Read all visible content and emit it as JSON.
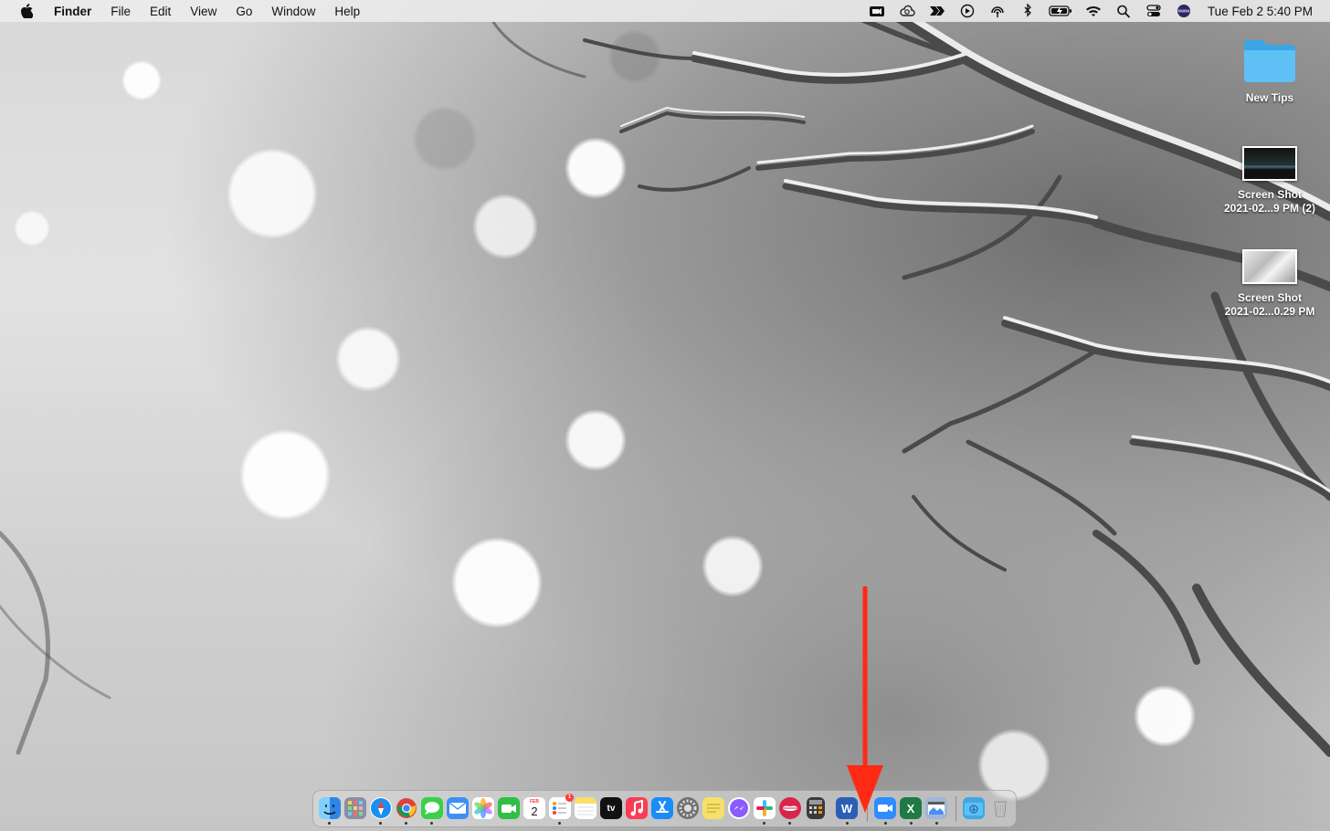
{
  "menubar": {
    "apple_icon": "apple-logo",
    "app_name": "Finder",
    "menus": [
      "File",
      "Edit",
      "View",
      "Go",
      "Window",
      "Help"
    ],
    "status_icons": [
      "video-record-icon",
      "cloud-sync-icon",
      "fast-forward-icon",
      "play-circle-icon",
      "airdrop-icon",
      "bluetooth-icon",
      "battery-charging-icon",
      "wifi-icon",
      "spotlight-search-icon",
      "control-center-icon",
      "siri-icon"
    ],
    "clock": "Tue Feb 2  5:40 PM"
  },
  "desktop": {
    "items": [
      {
        "label": "New Tips",
        "type": "folder"
      },
      {
        "label_line1": "Screen Shot",
        "label_line2": "2021-02...9 PM (2)",
        "type": "screenshot"
      },
      {
        "label_line1": "Screen Shot",
        "label_line2": "2021-02...0.29 PM",
        "type": "screenshot"
      }
    ]
  },
  "dock": {
    "apps": [
      {
        "name": "Finder",
        "icon": "finder-icon",
        "color": "#2e86e6",
        "running": true
      },
      {
        "name": "Launchpad",
        "icon": "launchpad-icon",
        "color": "#8a8fa3",
        "running": false
      },
      {
        "name": "Safari",
        "icon": "safari-icon",
        "color": "#1b8ff0",
        "running": true
      },
      {
        "name": "Chrome",
        "icon": "chrome-icon",
        "color": "#ffffff",
        "running": true
      },
      {
        "name": "Messages",
        "icon": "messages-icon",
        "color": "#3ad04a",
        "running": true
      },
      {
        "name": "Mail",
        "icon": "mail-icon",
        "color": "#3b8ff5",
        "running": false
      },
      {
        "name": "Photos",
        "icon": "photos-icon",
        "color": "#ffffff",
        "running": false
      },
      {
        "name": "FaceTime",
        "icon": "facetime-icon",
        "color": "#2fbf45",
        "running": false
      },
      {
        "name": "Calendar",
        "icon": "calendar-icon",
        "color": "#ffffff",
        "running": false,
        "text": "2",
        "month": "FEB"
      },
      {
        "name": "Reminders",
        "icon": "reminders-icon",
        "color": "#ffffff",
        "running": true,
        "badge": "1"
      },
      {
        "name": "Notes",
        "icon": "notes-icon",
        "color": "#f8e06a",
        "running": false
      },
      {
        "name": "TV",
        "icon": "apple-tv-icon",
        "color": "#111111",
        "running": false,
        "text": "tv"
      },
      {
        "name": "Music",
        "icon": "music-icon",
        "color": "#fb3c55",
        "running": false
      },
      {
        "name": "App Store",
        "icon": "app-store-icon",
        "color": "#1a8cf5",
        "running": false
      },
      {
        "name": "System Preferences",
        "icon": "system-preferences-icon",
        "color": "#707070",
        "running": false
      },
      {
        "name": "Stickies",
        "icon": "stickies-icon",
        "color": "#f5e06c",
        "running": false
      },
      {
        "name": "Messenger",
        "icon": "messenger-icon",
        "color": "#ffffff",
        "running": false
      },
      {
        "name": "Slack",
        "icon": "slack-icon",
        "color": "#ffffff",
        "running": true
      },
      {
        "name": "Lipstick App",
        "icon": "lips-icon",
        "color": "#d6264c",
        "running": true
      },
      {
        "name": "Calculator",
        "icon": "calculator-icon",
        "color": "#3a3a3a",
        "running": false
      },
      {
        "name": "Word",
        "icon": "word-icon",
        "color": "#2b5fb4",
        "running": true,
        "text": "W"
      },
      {
        "name": "Zoom",
        "icon": "zoom-icon",
        "color": "#2d8cff",
        "running": true
      },
      {
        "name": "Excel",
        "icon": "excel-icon",
        "color": "#1f7a45",
        "running": true,
        "text": "X"
      },
      {
        "name": "Preview",
        "icon": "preview-icon",
        "color": "#9fb7d6",
        "running": true
      },
      {
        "name": "Downloads",
        "icon": "downloads-folder-icon",
        "color": "#3ea8e5",
        "running": false
      },
      {
        "name": "Trash",
        "icon": "trash-icon",
        "color": "#b8b8b8",
        "running": false
      }
    ]
  },
  "annotation": {
    "arrow_color": "#ff2a14",
    "points_to": "dock-separator"
  }
}
